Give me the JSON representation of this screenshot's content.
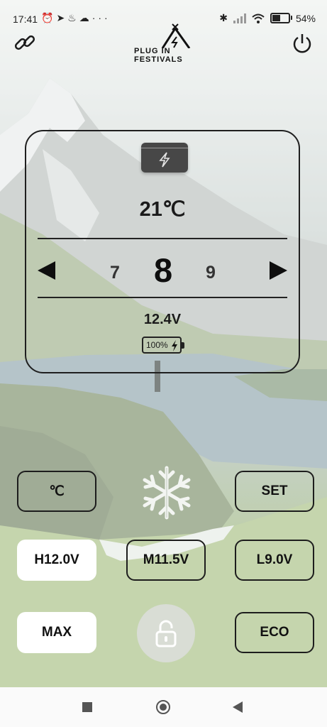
{
  "status_bar": {
    "time": "17:41",
    "notification_icons": [
      "alarm-icon",
      "telegram-icon",
      "app-icon",
      "cloud-icon",
      "more-dots-icon"
    ],
    "more_dots": "···",
    "system_icons": [
      "bluetooth-icon",
      "signal-icon",
      "wifi-icon",
      "battery-icon"
    ],
    "battery_percent": "54",
    "battery_level": 0.54
  },
  "header": {
    "logo_line1": "PLUG IN",
    "logo_line2": "FESTIVALS",
    "left_icon": "link-icon",
    "right_icon": "power-icon"
  },
  "panel": {
    "badge_icon": "bolt-icon",
    "temperature": "21℃",
    "level_prev": "7",
    "level_current": "8",
    "level_next": "9",
    "voltage": "12.4V",
    "battery_percent_label": "100%"
  },
  "controls": {
    "unit_button": "℃",
    "mode_icon": "snowflake-icon",
    "set_button": "SET",
    "voltage_high": "H12.0V",
    "voltage_mid": "M11.5V",
    "voltage_low": "L9.0V",
    "max_button": "MAX",
    "lock_icon": "unlock-icon",
    "eco_button": "ECO",
    "selected_voltage": "H12.0V",
    "selected_mode": "MAX"
  },
  "nav_bar": {
    "icons": [
      "recents-square-icon",
      "home-circle-icon",
      "back-triangle-icon"
    ]
  },
  "colors": {
    "panel_border": "#1f1f1f",
    "badge": "#474747",
    "active_button": "#ffffff"
  }
}
